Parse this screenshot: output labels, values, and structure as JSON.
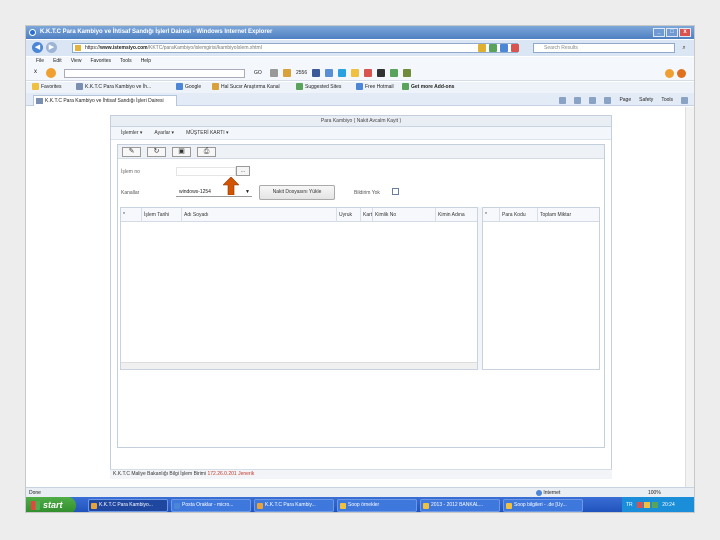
{
  "window": {
    "title": "K.K.T.C Para Kambiyo ve İhtisaf Sandığı İşlerl Dairesi - Windows Internet Explorer"
  },
  "address": {
    "url_prefix": "https://",
    "url_domain": "www.istemsiyo.com",
    "url_rest": "/KKTC/paraKambiyo/islemgirisi/kambiyoIslem.xhtml",
    "search_placeholder": "Search Results"
  },
  "menu": [
    "File",
    "Edit",
    "View",
    "Favorites",
    "Tools",
    "Help"
  ],
  "toolbar": {
    "go": "GO",
    "items": [
      "2556",
      "Hal Sucsr Araştırma Kanal",
      "Suggested Sites",
      "Free Hotmail",
      "Get more Add-ons"
    ]
  },
  "favorites": {
    "label": "Favorites",
    "items": [
      "K.K.T.C Para Kambiyo ve İh...",
      "Google",
      "Hal Sucsr Araştırma Kanal",
      "Suggested Sites",
      "Free Hotmail",
      "Get more Add-ons"
    ]
  },
  "tab": {
    "label": "K.K.T.C Para Kambiyo ve İhtisaf Sandığı İşleri Dairesi"
  },
  "commandbar": [
    "Page",
    "Safety",
    "Tools"
  ],
  "app": {
    "title": "Para Kambiyo ( Nakit Avcalm Kayit )",
    "menu": [
      "İşlemler",
      "Ayarlar",
      "MÜŞTERİ KARTI"
    ],
    "toolbar_buttons": [
      "edit",
      "refresh",
      "save",
      "print"
    ],
    "islem_no_label": "İşlem no",
    "islem_btn": "...",
    "kanal_label": "Kanallar",
    "kanal_value": "windows-1254",
    "nakit_btn": "Nakit Dosyasını Yükle",
    "bildirim_label": "Bildirim Yok",
    "grid1_columns": [
      "*",
      "İşlem Tarihi",
      "Adı Soyadı",
      "Uyruk",
      "Kart",
      "Kimlik No",
      "Kimin Adına"
    ],
    "grid2_columns": [
      "*",
      "Para Kodu",
      "Toplam Miktar"
    ]
  },
  "status": {
    "text": "K.K.T.C Maliye Bakanlığı Bilgi İşlem Birimi ",
    "ip": "172.26.0.201",
    "suffix": "Jenerik"
  },
  "ie_status": {
    "left": "Done",
    "zone": "Internet",
    "zoom": "100%"
  },
  "taskbar": {
    "start": "start",
    "tasks": [
      "K.K.T.C Para Kambiyo...",
      "Posta Oraklar - micro...",
      "K.K.T.C Para Kambiy...",
      "Soop örnekler",
      "2013 - 2012 BANKAL...",
      "Soop bilgileri - .de [Uy..."
    ],
    "lang": "TR",
    "time": "20:24"
  },
  "colors": {
    "titlebar": "#4d7fc2",
    "taskbar": "#1d4fb8",
    "start": "#2f8a2a",
    "arrow": "#d35400"
  }
}
